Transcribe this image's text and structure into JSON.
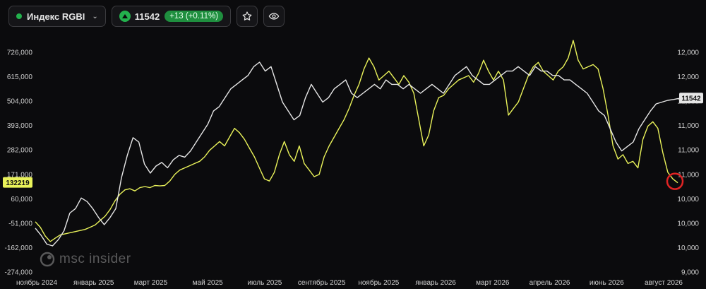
{
  "toolbar": {
    "index_name": "Индекс RGBI",
    "price": "11542",
    "change": "+13 (+0.11%)",
    "status_color": "#23b14d"
  },
  "watermark": {
    "text": "msc insider"
  },
  "chart_data": {
    "type": "line",
    "title": "",
    "x_tick_labels": [
      "ноябрь 2024",
      "январь 2025",
      "март 2025",
      "май 2025",
      "июль 2025",
      "сентябрь 2025",
      "ноябрь 2025",
      "январь 2026",
      "март 2026",
      "апрель 2026",
      "июнь 2026",
      "август 2026"
    ],
    "left_axis": {
      "ticks": [
        "726,000",
        "615,000",
        "504,000",
        "393,000",
        "282,000",
        "171,000",
        "60,000",
        "-51,000",
        "-162,000",
        "-274,000"
      ],
      "range": [
        -274000,
        726000
      ]
    },
    "right_axis": {
      "ticks": [
        "12,000",
        "12,000",
        "12,000",
        "11,000",
        "11,000",
        "11,000",
        "10,000",
        "10,000",
        "10,000",
        "9,000"
      ]
    },
    "left_last_value_label": "132219",
    "right_last_value_label": "11542",
    "series": [
      {
        "color": "#e9f25a",
        "axis": "left",
        "values": [
          -45000,
          -70000,
          -110000,
          -135000,
          -120000,
          -105000,
          -100000,
          -95000,
          -90000,
          -85000,
          -80000,
          -70000,
          -60000,
          -40000,
          -20000,
          10000,
          50000,
          80000,
          100000,
          105000,
          95000,
          110000,
          115000,
          110000,
          120000,
          118000,
          120000,
          140000,
          170000,
          190000,
          200000,
          210000,
          220000,
          230000,
          250000,
          280000,
          300000,
          320000,
          300000,
          340000,
          380000,
          360000,
          330000,
          290000,
          250000,
          200000,
          150000,
          140000,
          180000,
          260000,
          320000,
          260000,
          230000,
          300000,
          220000,
          190000,
          160000,
          170000,
          250000,
          300000,
          340000,
          380000,
          420000,
          470000,
          530000,
          580000,
          650000,
          700000,
          660000,
          600000,
          620000,
          640000,
          610000,
          580000,
          620000,
          590000,
          540000,
          420000,
          300000,
          350000,
          460000,
          520000,
          530000,
          560000,
          580000,
          600000,
          610000,
          620000,
          590000,
          630000,
          690000,
          640000,
          600000,
          640000,
          600000,
          440000,
          470000,
          500000,
          560000,
          620000,
          660000,
          680000,
          640000,
          620000,
          600000,
          640000,
          660000,
          700000,
          780000,
          690000,
          650000,
          660000,
          670000,
          650000,
          560000,
          440000,
          300000,
          240000,
          260000,
          220000,
          230000,
          200000,
          330000,
          390000,
          410000,
          380000,
          270000,
          180000,
          150000,
          132219
        ]
      },
      {
        "color": "#e6e6e6",
        "axis": "right",
        "values": [
          10080,
          10000,
          9900,
          9880,
          9950,
          10050,
          10250,
          10300,
          10420,
          10380,
          10300,
          10200,
          10120,
          10200,
          10300,
          10650,
          10900,
          11100,
          11050,
          10800,
          10700,
          10780,
          10820,
          10760,
          10850,
          10900,
          10880,
          10950,
          11050,
          11150,
          11250,
          11400,
          11450,
          11550,
          11650,
          11700,
          11750,
          11800,
          11900,
          11950,
          11850,
          11900,
          11700,
          11500,
          11400,
          11300,
          11350,
          11550,
          11700,
          11600,
          11500,
          11550,
          11650,
          11700,
          11750,
          11600,
          11550,
          11600,
          11650,
          11700,
          11650,
          11750,
          11700,
          11700,
          11650,
          11700,
          11650,
          11600,
          11650,
          11700,
          11650,
          11600,
          11700,
          11800,
          11850,
          11900,
          11800,
          11750,
          11700,
          11700,
          11750,
          11800,
          11850,
          11850,
          11900,
          11850,
          11800,
          11900,
          11850,
          11850,
          11800,
          11800,
          11750,
          11750,
          11700,
          11650,
          11600,
          11500,
          11400,
          11350,
          11200,
          11050,
          10950,
          11000,
          11050,
          11200,
          11300,
          11400,
          11480,
          11500,
          11520,
          11530,
          11542
        ]
      }
    ],
    "marker": {
      "color": "#e02424"
    }
  }
}
